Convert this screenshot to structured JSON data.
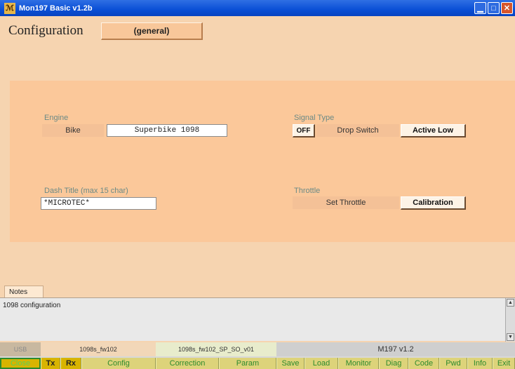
{
  "window": {
    "title": "Mon197 Basic v1.2b",
    "app_icon": "ℳ"
  },
  "header": {
    "title": "Configuration",
    "section_button": "(general)"
  },
  "engine": {
    "label": "Engine",
    "model_button": "Bike",
    "model_value": "Superbike 1098"
  },
  "signal_type": {
    "label": "Signal Type",
    "off_button": "OFF",
    "switch_label": "Drop Switch",
    "mode_button": "Active Low"
  },
  "dash_title": {
    "label": "Dash Title (max 15 char)",
    "value": "*MICROTEC*"
  },
  "throttle": {
    "label": "Throttle",
    "set_button": "Set Throttle",
    "calibration_button": "Calibration"
  },
  "notes": {
    "tab_label": "Notes",
    "text": "1098 configuration"
  },
  "status": {
    "port": "USB",
    "file1": "1098s_fw102",
    "file2": "1098s_fw102_SP_SO_v01",
    "version": "M197 v1.2"
  },
  "nav": {
    "close": "Close",
    "tx": "Tx",
    "rx": "Rx",
    "config": "Config",
    "correction": "Correction",
    "param": "Param",
    "save": "Save",
    "load": "Load",
    "monitor": "Monitor",
    "diag": "Diag",
    "code": "Code",
    "pwd": "Pwd",
    "info": "Info",
    "exit": "Exit"
  },
  "colors": {
    "titlebar": "#0a4fd6",
    "background": "#f6d4b0",
    "panel": "#fbc89a",
    "nav_green": "#2d8a2d",
    "tx_active": "#d8b400"
  }
}
